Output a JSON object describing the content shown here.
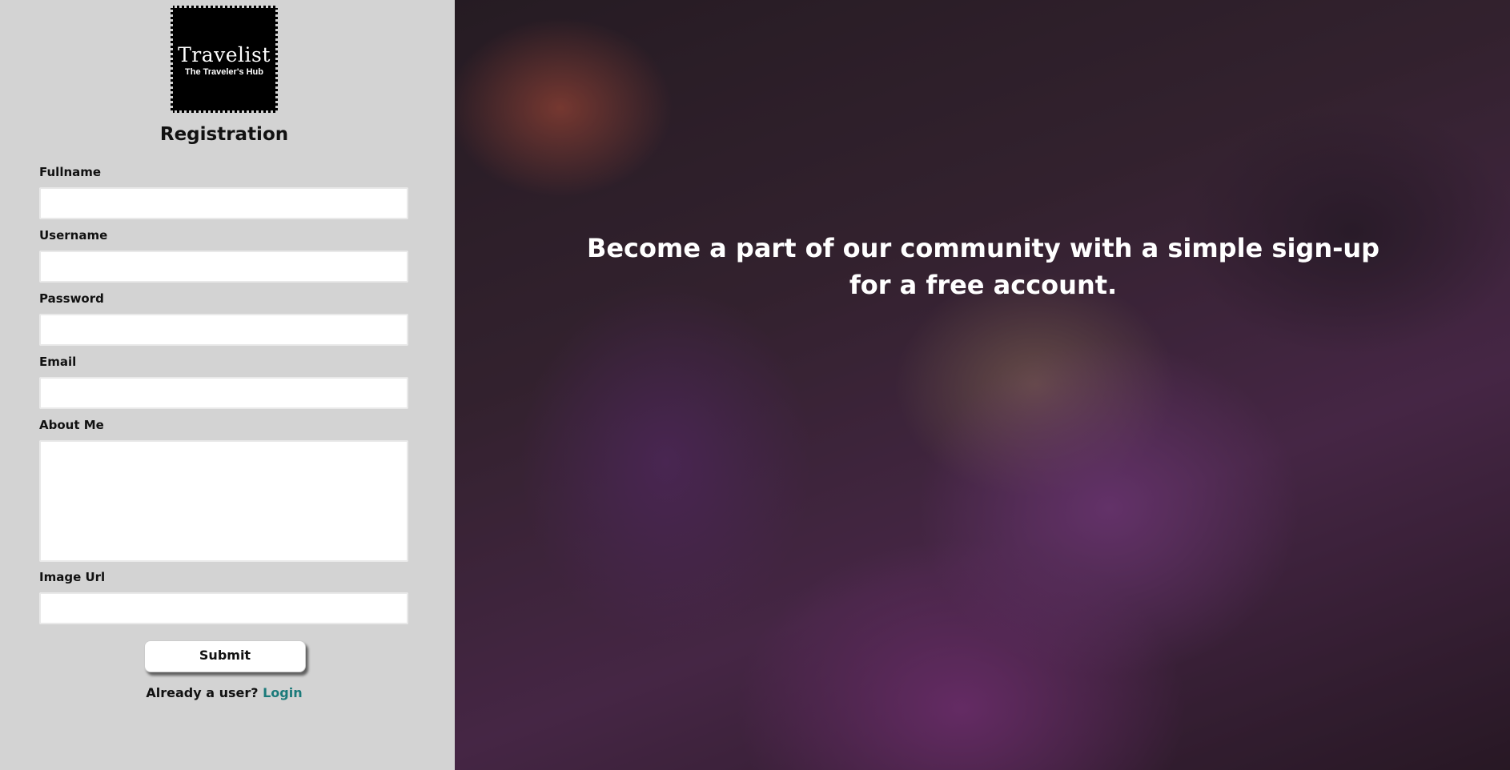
{
  "brand": {
    "name": "Travelist",
    "tagline": "The Traveler's Hub"
  },
  "form": {
    "title": "Registration",
    "fields": [
      {
        "label": "Fullname",
        "value": ""
      },
      {
        "label": "Username",
        "value": ""
      },
      {
        "label": "Password",
        "value": ""
      },
      {
        "label": "Email",
        "value": ""
      },
      {
        "label": "About Me",
        "value": ""
      },
      {
        "label": "Image Url",
        "value": ""
      }
    ],
    "submit_label": "Submit",
    "already_user_text": "Already a user?",
    "login_link": "Login"
  },
  "hero": {
    "text": "Become a part of our community with a simple sign-up for a free account."
  },
  "colors": {
    "panel_bg": "#d3d3d3",
    "link": "#1b7a7a"
  }
}
